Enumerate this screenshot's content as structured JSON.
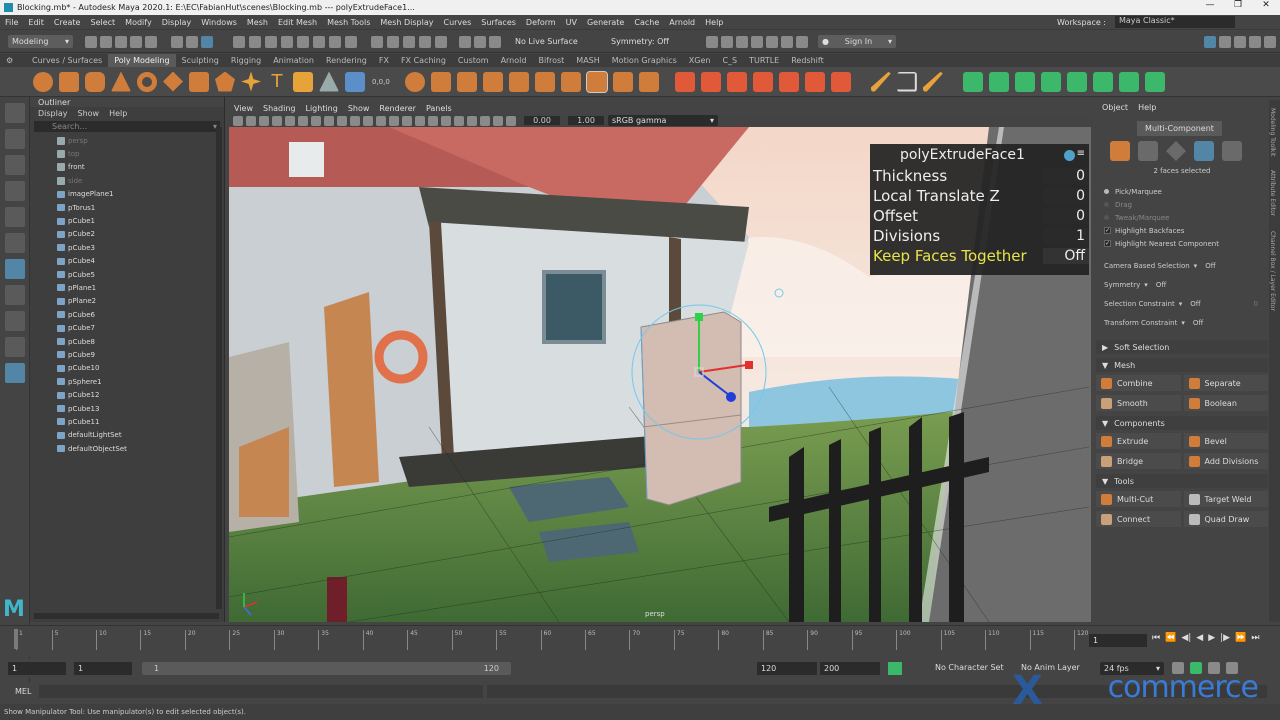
{
  "title_bar": {
    "text": "Blocking.mb* - Autodesk Maya 2020.1: E:\\EC\\FabianHut\\scenes\\Blocking.mb  ---  polyExtrudeFace1..."
  },
  "menu": [
    "File",
    "Edit",
    "Create",
    "Select",
    "Modify",
    "Display",
    "Windows",
    "Mesh",
    "Edit Mesh",
    "Mesh Tools",
    "Mesh Display",
    "Curves",
    "Surfaces",
    "Deform",
    "UV",
    "Generate",
    "Cache",
    "Arnold",
    "Help"
  ],
  "workspace": {
    "label": "Workspace :",
    "value": "Maya Classic*"
  },
  "status_line": {
    "mode": "Modeling",
    "live_surface": "No Live Surface",
    "symmetry": "Symmetry: Off",
    "sign_in": "Sign In"
  },
  "shelf_tabs": [
    "Curves / Surfaces",
    "Poly Modeling",
    "Sculpting",
    "Rigging",
    "Animation",
    "Rendering",
    "FX",
    "FX Caching",
    "Custom",
    "Arnold",
    "Bifrost",
    "MASH",
    "Motion Graphics",
    "XGen",
    "C_S",
    "TURTLE",
    "Redshift"
  ],
  "shelf_active": "Poly Modeling",
  "shelf_value": "0,0,0",
  "outliner": {
    "title": "Outliner",
    "menu": [
      "Display",
      "Show",
      "Help"
    ],
    "search_placeholder": "Search...",
    "items": [
      {
        "name": "persp",
        "kind": "camera",
        "dim": true
      },
      {
        "name": "top",
        "kind": "camera",
        "dim": true
      },
      {
        "name": "front",
        "kind": "camera",
        "dim": false
      },
      {
        "name": "side",
        "kind": "camera",
        "dim": true
      },
      {
        "name": "imagePlane1",
        "kind": "mesh",
        "dim": false
      },
      {
        "name": "pTorus1",
        "kind": "mesh",
        "dim": false
      },
      {
        "name": "pCube1",
        "kind": "mesh",
        "dim": false
      },
      {
        "name": "pCube2",
        "kind": "mesh",
        "dim": false
      },
      {
        "name": "pCube3",
        "kind": "mesh",
        "dim": false
      },
      {
        "name": "pCube4",
        "kind": "mesh",
        "dim": false
      },
      {
        "name": "pCube5",
        "kind": "mesh",
        "dim": false
      },
      {
        "name": "pPlane1",
        "kind": "mesh",
        "dim": false
      },
      {
        "name": "pPlane2",
        "kind": "mesh",
        "dim": false
      },
      {
        "name": "pCube6",
        "kind": "mesh",
        "dim": false
      },
      {
        "name": "pCube7",
        "kind": "mesh",
        "dim": false
      },
      {
        "name": "pCube8",
        "kind": "mesh",
        "dim": false
      },
      {
        "name": "pCube9",
        "kind": "mesh",
        "dim": false
      },
      {
        "name": "pCube10",
        "kind": "mesh",
        "dim": false
      },
      {
        "name": "pSphere1",
        "kind": "mesh",
        "dim": false
      },
      {
        "name": "pCube12",
        "kind": "mesh",
        "dim": false
      },
      {
        "name": "pCube13",
        "kind": "mesh",
        "dim": false
      },
      {
        "name": "pCube11",
        "kind": "mesh",
        "dim": false
      },
      {
        "name": "defaultLightSet",
        "kind": "set",
        "dim": false
      },
      {
        "name": "defaultObjectSet",
        "kind": "set",
        "dim": false
      }
    ]
  },
  "viewport": {
    "menu": [
      "View",
      "Shading",
      "Lighting",
      "Show",
      "Renderer",
      "Panels"
    ],
    "exposure": "0.00",
    "gamma": "1.00",
    "color_space": "sRGB gamma",
    "camera_label": "persp"
  },
  "hud": {
    "title": "polyExtrudeFace1",
    "rows": [
      {
        "label": "Thickness",
        "value": "0"
      },
      {
        "label": "Local Translate Z",
        "value": "0"
      },
      {
        "label": "Offset",
        "value": "0"
      },
      {
        "label": "Divisions",
        "value": "1"
      },
      {
        "label": "Keep Faces Together",
        "value": "Off",
        "highlight": true
      }
    ]
  },
  "modeling_toolkit": {
    "menu": [
      "Object",
      "Help"
    ],
    "mode_button": "Multi-Component",
    "selection_info": "2 faces selected",
    "pick_options": [
      {
        "label": "Pick/Marquee",
        "active": true
      },
      {
        "label": "Drag",
        "active": false
      },
      {
        "label": "Tweak/Marquee",
        "active": false
      }
    ],
    "checkboxes": [
      "Highlight Backfaces",
      "Highlight Nearest Component"
    ],
    "dropdowns": [
      {
        "label": "Camera Based Selection",
        "value": "Off"
      },
      {
        "label": "Symmetry",
        "value": "Off"
      },
      {
        "label": "Selection Constraint",
        "value": "Off",
        "extra": "0"
      },
      {
        "label": "Transform Constraint",
        "value": "Off"
      }
    ],
    "soft_selection": "Soft Selection",
    "sections": [
      {
        "title": "Mesh",
        "buttons": [
          "Combine",
          "Separate",
          "Smooth",
          "Boolean"
        ]
      },
      {
        "title": "Components",
        "buttons": [
          "Extrude",
          "Bevel",
          "Bridge",
          "Add Divisions"
        ]
      },
      {
        "title": "Tools",
        "buttons": [
          "Multi-Cut",
          "Target Weld",
          "Connect",
          "Quad Draw"
        ]
      }
    ]
  },
  "side_tabs": [
    "Modeling Toolkit",
    "Attribute Editor",
    "Channel Box / Layer Editor"
  ],
  "timeline": {
    "ticks": [
      "1",
      "5",
      "10",
      "15",
      "20",
      "25",
      "30",
      "35",
      "40",
      "45",
      "50",
      "55",
      "60",
      "65",
      "70",
      "75",
      "80",
      "85",
      "90",
      "95",
      "100",
      "105",
      "110",
      "115",
      "120"
    ],
    "current_frame": "1",
    "range": {
      "start": "1",
      "inner_start": "1",
      "slider_start": "1",
      "slider_end": "120",
      "inner_end": "120",
      "end": "200"
    },
    "character_set": "No Character Set",
    "anim_layer": "No Anim Layer",
    "fps": "24 fps"
  },
  "command_line": {
    "label": "MEL"
  },
  "help_line": "Show Manipulator Tool: Use manipulator(s) to edit selected object(s).",
  "watermark": {
    "letter": "X",
    "text": "commerce"
  }
}
